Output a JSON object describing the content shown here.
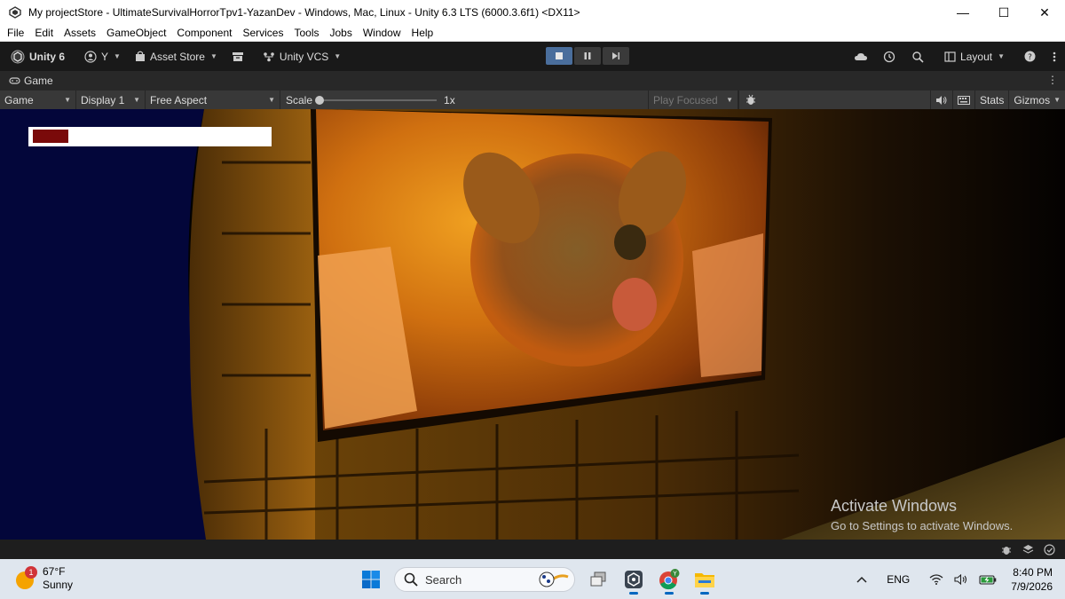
{
  "window": {
    "title": "My projectStore - UltimateSurvivalHorrorTpv1-YazanDev - Windows, Mac, Linux - Unity 6.3 LTS (6000.3.6f1) <DX11>"
  },
  "menu": [
    "File",
    "Edit",
    "Assets",
    "GameObject",
    "Component",
    "Services",
    "Tools",
    "Jobs",
    "Window",
    "Help"
  ],
  "toolbar": {
    "unity_label": "Unity 6",
    "account_label": "Y",
    "asset_store_label": "Asset Store",
    "vcs_label": "Unity VCS",
    "layout_label": "Layout"
  },
  "game_tab": {
    "label": "Game"
  },
  "game_controls": {
    "view_select": "Game",
    "display_select": "Display 1",
    "aspect_select": "Free Aspect",
    "scale_label": "Scale",
    "scale_value": "1x",
    "play_focused": "Play Focused",
    "stats_label": "Stats",
    "gizmos_label": "Gizmos"
  },
  "hud": {
    "health_fraction": 0.15
  },
  "watermark": {
    "line1": "Activate Windows",
    "line2": "Go to Settings to activate Windows."
  },
  "taskbar": {
    "weather_temp": "67°F",
    "weather_cond": "Sunny",
    "weather_badge": "1",
    "search_placeholder": "Search",
    "chrome_badge": "Y",
    "lang": "ENG",
    "time": "8:40 PM",
    "date": "7/9/2026"
  }
}
